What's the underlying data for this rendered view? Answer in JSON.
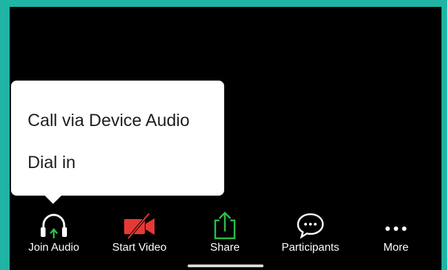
{
  "audio_menu": {
    "items": [
      {
        "label": "Call via Device Audio"
      },
      {
        "label": "Dial in"
      }
    ]
  },
  "toolbar": {
    "items": [
      {
        "label": "Join Audio",
        "icon": "headphones-icon",
        "accent": "#2bbf4a"
      },
      {
        "label": "Start Video",
        "icon": "video-off-icon",
        "accent": "#e53935"
      },
      {
        "label": "Share",
        "icon": "share-icon",
        "accent": "#2bbf4a"
      },
      {
        "label": "Participants",
        "icon": "chat-bubble-icon",
        "accent": "#ffffff"
      },
      {
        "label": "More",
        "icon": "more-dots-icon",
        "accent": "#ffffff"
      }
    ]
  },
  "colors": {
    "frame": "#1fb4a3",
    "background": "#000000",
    "popup": "#ffffff"
  }
}
